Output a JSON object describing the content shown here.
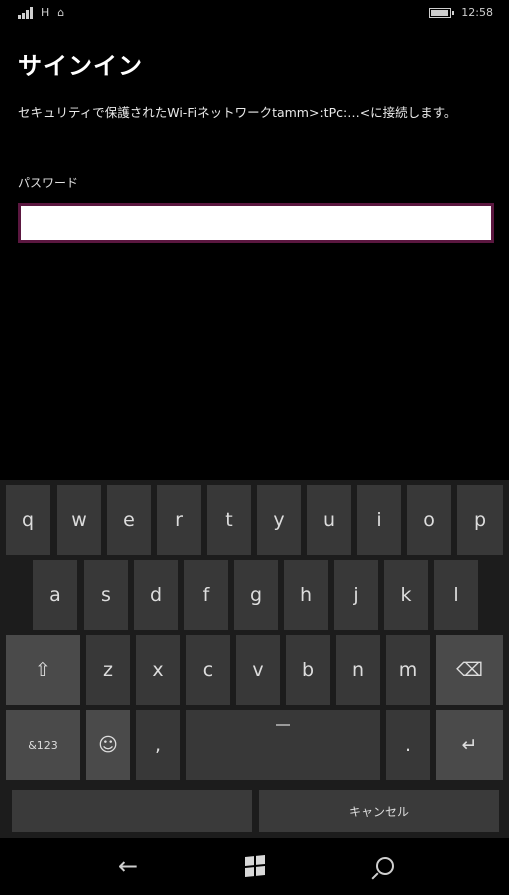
{
  "status": {
    "network": "H",
    "time": "12:58",
    "battery_level": 0.85
  },
  "page": {
    "title": "サインイン",
    "message": "セキュリティで保護されたWi-Fiネットワークtamm>:tPc:…<に接続します。",
    "password_label": "パスワード",
    "password_value": ""
  },
  "keyboard": {
    "row1": [
      "q",
      "w",
      "e",
      "r",
      "t",
      "y",
      "u",
      "i",
      "o",
      "p"
    ],
    "row2": [
      "a",
      "s",
      "d",
      "f",
      "g",
      "h",
      "j",
      "k",
      "l"
    ],
    "row3": [
      "z",
      "x",
      "c",
      "v",
      "b",
      "n",
      "m"
    ],
    "shift_glyph": "⇧",
    "backspace_glyph": "⌫",
    "mode_label": "&123",
    "emoji_glyph": "☺",
    "comma": ",",
    "period": ".",
    "enter_glyph": "↵"
  },
  "suggestions": {
    "left": "",
    "right": "キャンセル"
  },
  "nav": {
    "back_glyph": "←"
  }
}
